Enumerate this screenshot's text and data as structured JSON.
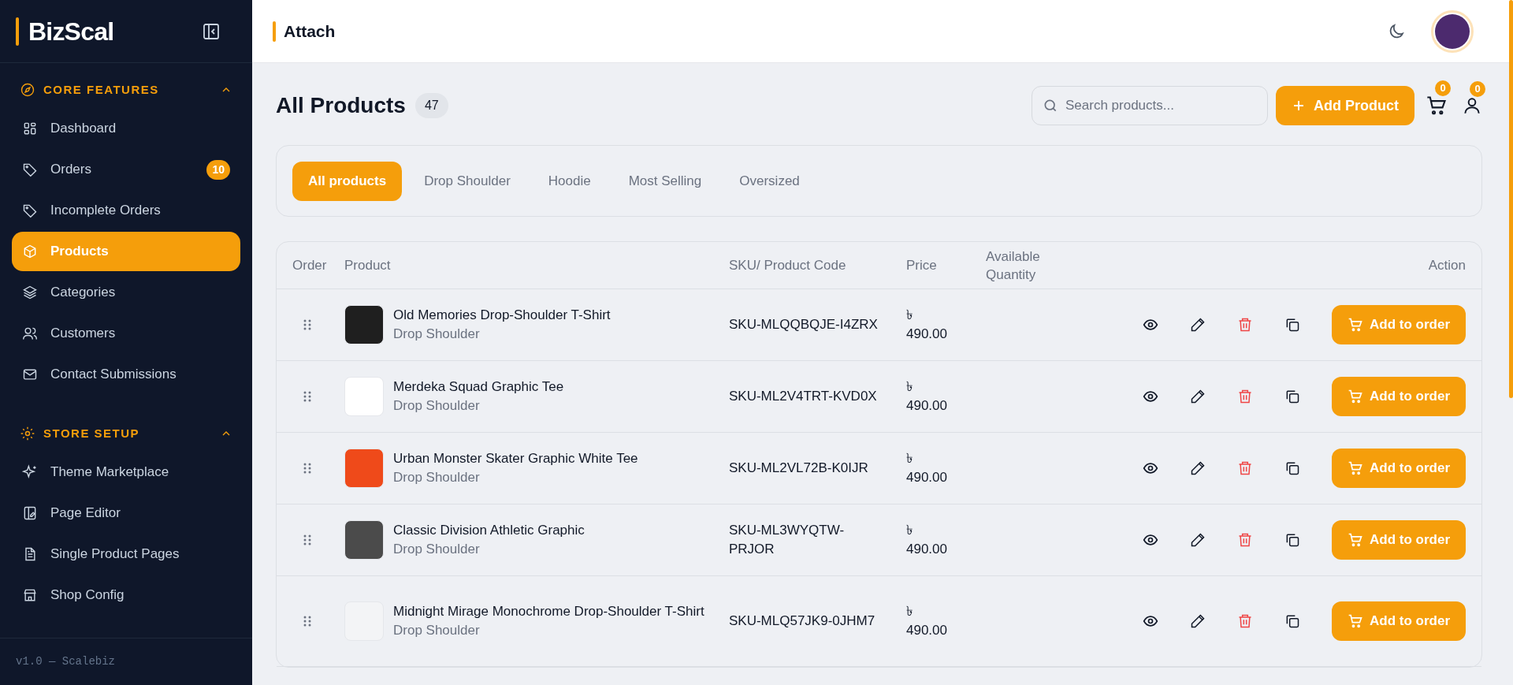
{
  "sidebar": {
    "logo": "BizScal",
    "sections": [
      {
        "title": "CORE FEATURES",
        "expanded": true,
        "items": [
          {
            "label": "Dashboard",
            "selected": false
          },
          {
            "label": "Orders",
            "selected": false,
            "badge": "10"
          },
          {
            "label": "Incomplete Orders",
            "selected": false
          },
          {
            "label": "Products",
            "selected": true
          },
          {
            "label": "Categories",
            "selected": false
          },
          {
            "label": "Customers",
            "selected": false
          },
          {
            "label": "Contact Submissions",
            "selected": false
          }
        ]
      },
      {
        "title": "STORE SETUP",
        "expanded": true,
        "items": [
          {
            "label": "Theme Marketplace",
            "selected": false
          },
          {
            "label": "Page Editor",
            "selected": false
          },
          {
            "label": "Single Product Pages",
            "selected": false
          },
          {
            "label": "Shop Config",
            "selected": false
          }
        ]
      }
    ],
    "footer": "v1.0 — Scalebiz"
  },
  "header": {
    "title": "Attach"
  },
  "page": {
    "title": "All Products",
    "count": "47",
    "search": {
      "placeholder": "Search products..."
    },
    "add_button": "Add Product",
    "cart_count": "0",
    "user_count": "0"
  },
  "tabs": [
    {
      "label": "All products",
      "selected": true
    },
    {
      "label": "Drop Shoulder",
      "selected": false
    },
    {
      "label": "Hoodie",
      "selected": false
    },
    {
      "label": "Most Selling",
      "selected": false
    },
    {
      "label": "Oversized",
      "selected": false
    }
  ],
  "table": {
    "columns": [
      "Order",
      "Product",
      "SKU/ Product Code",
      "Price",
      "Available Quantity",
      "Action"
    ],
    "rows": [
      {
        "name": "Old Memories Drop-Shoulder T-Shirt",
        "category": "Drop Shoulder",
        "sku": "SKU-MLQQBQJE-I4ZRX",
        "price": "৳ 490.00",
        "action": "Add to order"
      },
      {
        "name": "Merdeka Squad Graphic Tee",
        "category": "Drop Shoulder",
        "sku": "SKU-ML2V4TRT-KVD0X",
        "price": "৳ 490.00",
        "action": "Add to order"
      },
      {
        "name": "Urban Monster Skater Graphic White Tee",
        "category": "Drop Shoulder",
        "sku": "SKU-ML2VL72B-K0IJR",
        "price": "৳ 490.00",
        "action": "Add to order"
      },
      {
        "name": "Classic Division Athletic Graphic",
        "category": "Drop Shoulder",
        "sku": "SKU-ML3WYQTW-PRJOR",
        "price": "৳ 490.00",
        "action": "Add to order"
      },
      {
        "name": "Midnight Mirage Monochrome Drop-Shoulder T-Shirt",
        "category": "Drop Shoulder",
        "sku": "SKU-MLQ57JK9-0JHM7",
        "price": "৳ 490.00",
        "action": "Add to order"
      }
    ]
  }
}
